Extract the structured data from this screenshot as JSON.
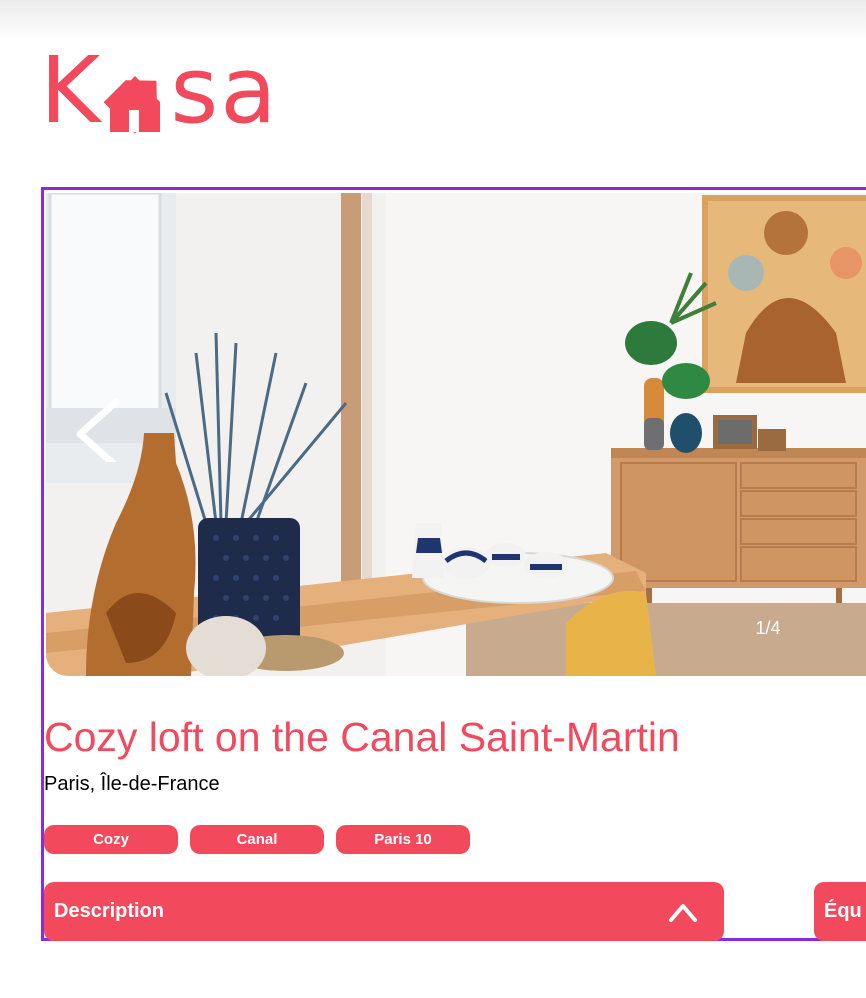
{
  "brand": {
    "logo_left": "K",
    "logo_right": "sa",
    "accent_color": "#F2495C"
  },
  "gallery": {
    "counter": "1/4",
    "prev_icon": "chevron-left-icon"
  },
  "listing": {
    "title": "Cozy loft on the Canal Saint-Martin",
    "location": "Paris, Île-de-France",
    "tags": [
      "Cozy",
      "Canal",
      "Paris 10"
    ]
  },
  "sections": {
    "description_label": "Description",
    "equipments_label": "Équ",
    "toggle_icon": "chevron-up-icon"
  }
}
